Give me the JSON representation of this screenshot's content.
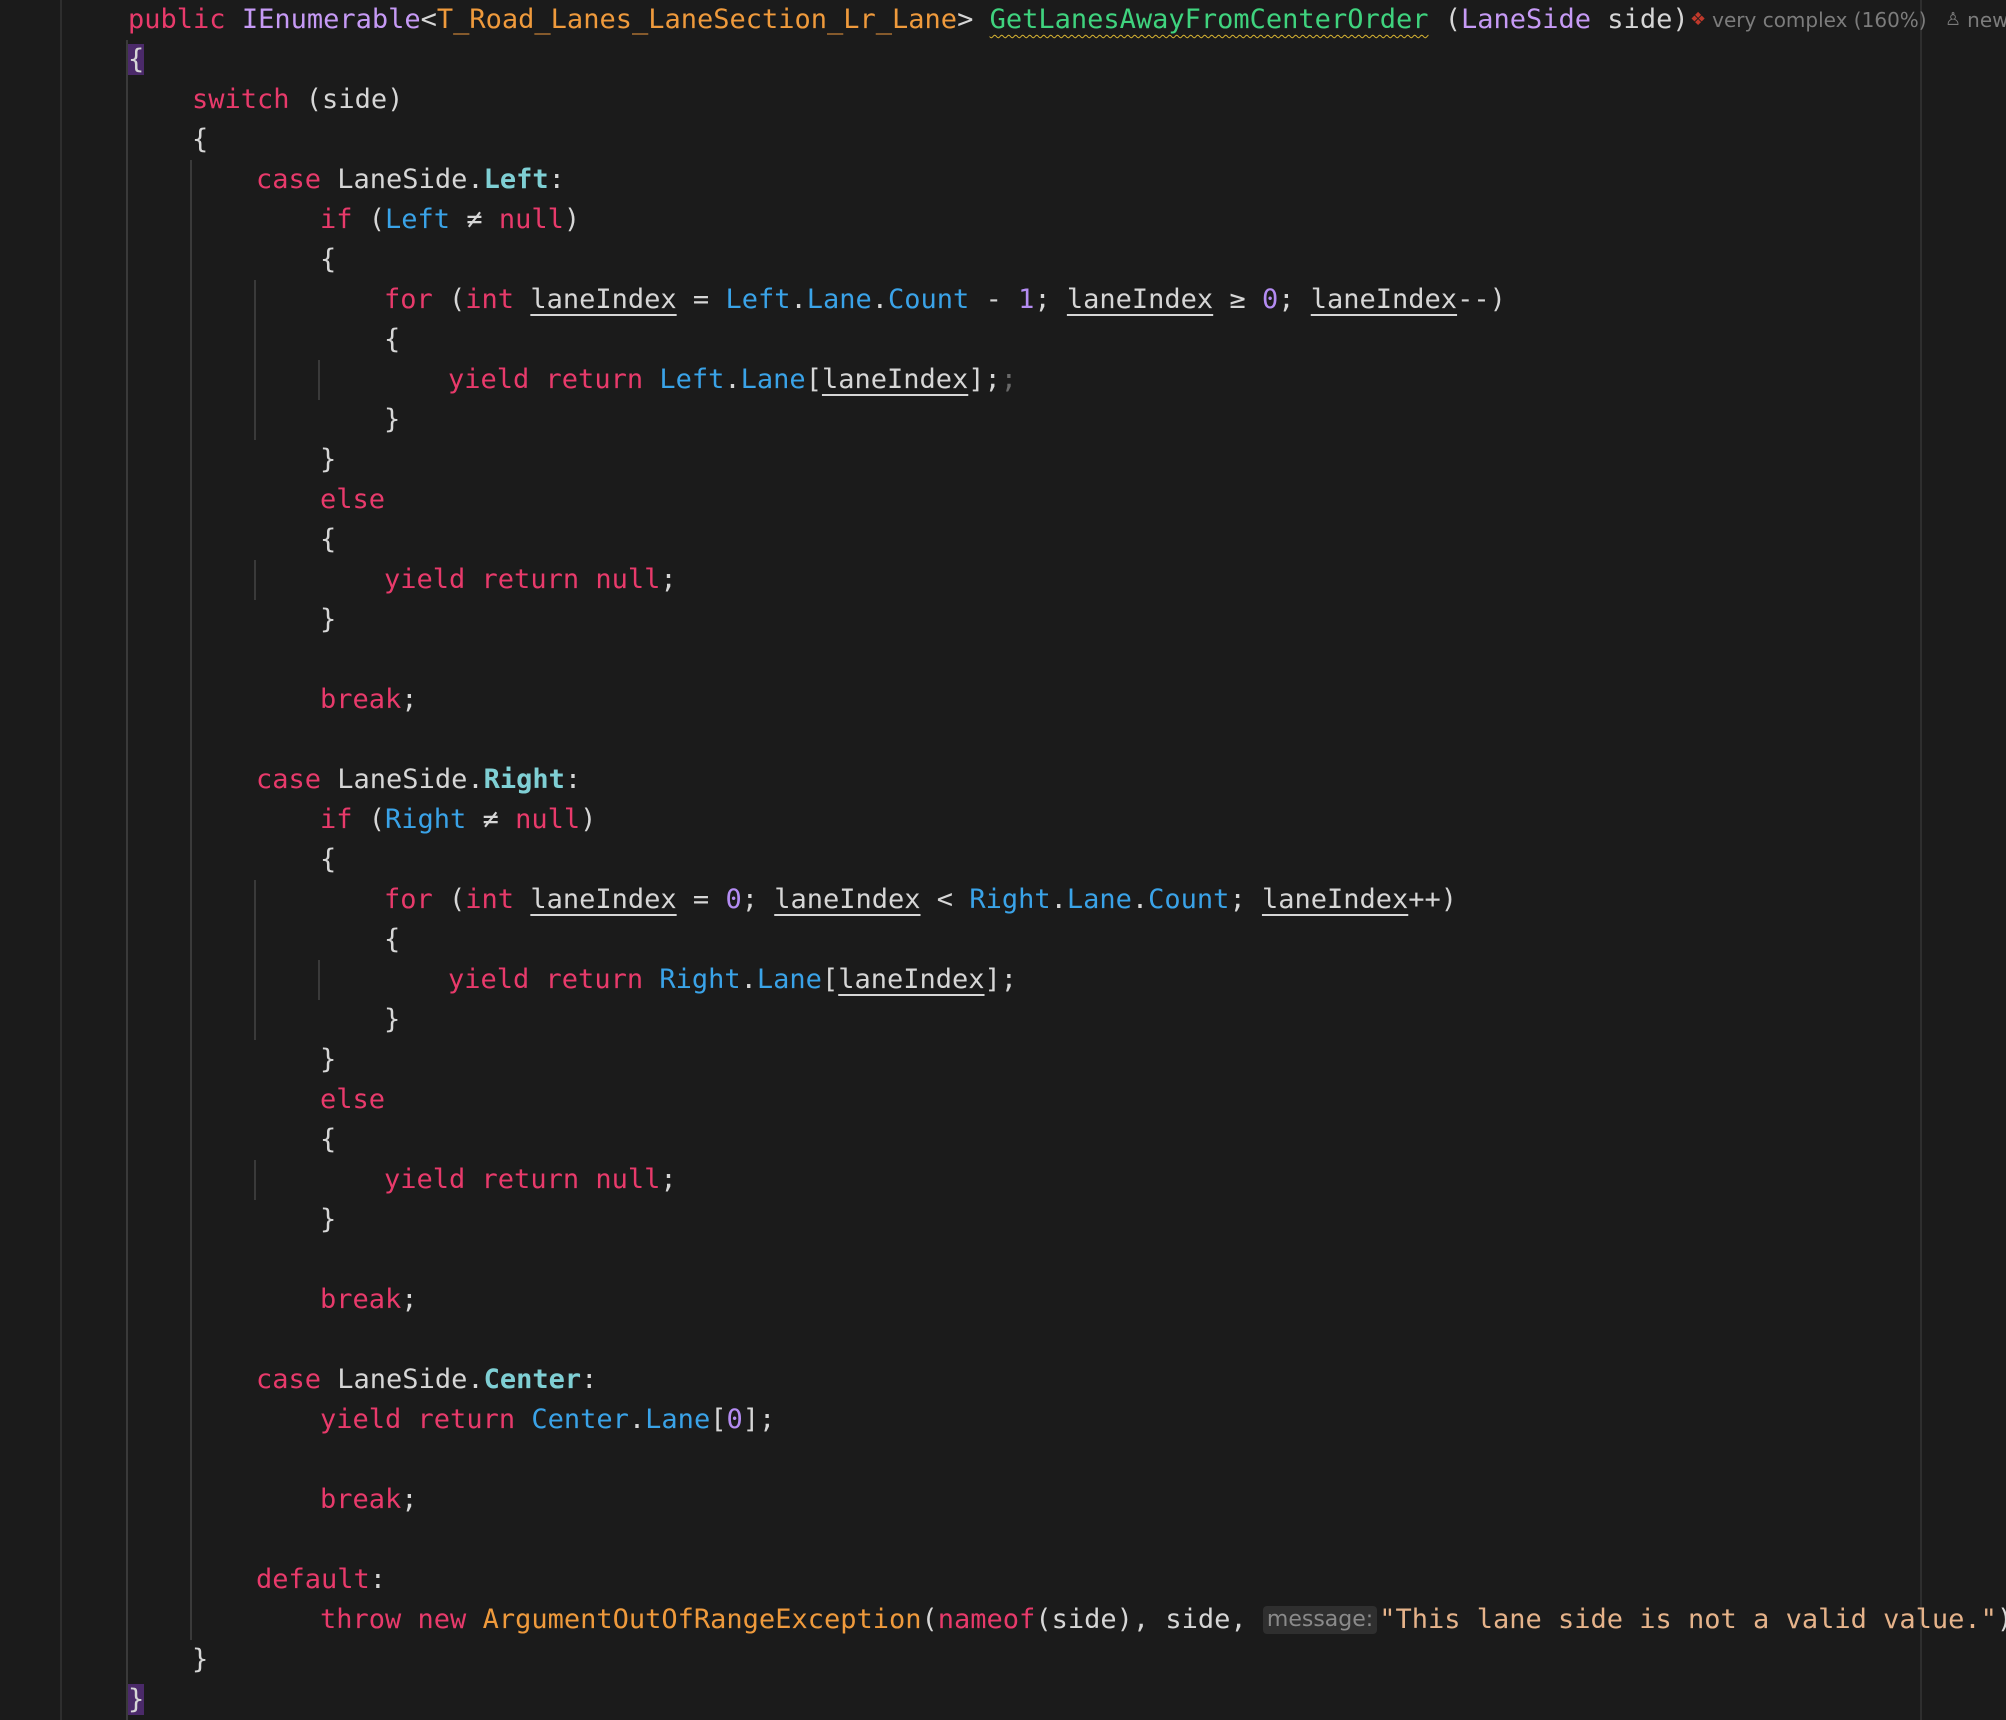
{
  "code_lens": {
    "complexity_icon": "complexity-warning-icon",
    "complexity_label": "very complex (160%)",
    "author_icon": "person-icon",
    "author_label": "new"
  },
  "colors": {
    "background": "#1b1b1b",
    "keyword": "#e83a6b",
    "type": "#c69af5",
    "generic_type": "#ef9a3c",
    "method_name": "#3fd37e",
    "property": "#3aa3e8",
    "enum_member": "#7fcfd4",
    "number": "#b48cf2",
    "string": "#e6b38a",
    "brace_highlight": "#4b2a6a"
  },
  "code_lines": [
    [
      [
        "kw",
        "public"
      ],
      [
        "plain",
        " "
      ],
      [
        "type",
        "IEnumerable"
      ],
      [
        "plain",
        "<"
      ],
      [
        "generic",
        "T_Road_Lanes_LaneSection_Lr_Lane"
      ],
      [
        "plain",
        "> "
      ],
      [
        "method",
        "GetLanesAwayFromCenterOrder"
      ],
      [
        "plain",
        " ("
      ],
      [
        "type",
        "LaneSide"
      ],
      [
        "plain",
        " side)"
      ]
    ],
    [
      [
        "bracehl",
        "{"
      ]
    ],
    [
      [
        "kw",
        "switch"
      ],
      [
        "plain",
        " (side)"
      ]
    ],
    [
      [
        "plain",
        "{"
      ]
    ],
    [
      [
        "kw",
        "case"
      ],
      [
        "plain",
        " LaneSide."
      ],
      [
        "enum",
        "Left"
      ],
      [
        "plain",
        ":"
      ]
    ],
    [
      [
        "kw",
        "if"
      ],
      [
        "plain",
        " ("
      ],
      [
        "prop",
        "Left"
      ],
      [
        "plain",
        " ≠ "
      ],
      [
        "kw",
        "null"
      ],
      [
        "plain",
        ")"
      ]
    ],
    [
      [
        "plain",
        "{"
      ]
    ],
    [
      [
        "kw",
        "for"
      ],
      [
        "plain",
        " ("
      ],
      [
        "kw",
        "int"
      ],
      [
        "plain",
        " "
      ],
      [
        "local",
        "laneIndex"
      ],
      [
        "plain",
        " = "
      ],
      [
        "prop",
        "Left"
      ],
      [
        "plain",
        "."
      ],
      [
        "prop",
        "Lane"
      ],
      [
        "plain",
        "."
      ],
      [
        "prop",
        "Count"
      ],
      [
        "plain",
        " - "
      ],
      [
        "num",
        "1"
      ],
      [
        "plain",
        "; "
      ],
      [
        "local",
        "laneIndex"
      ],
      [
        "plain",
        " ≥ "
      ],
      [
        "num",
        "0"
      ],
      [
        "plain",
        "; "
      ],
      [
        "local",
        "laneIndex"
      ],
      [
        "plain",
        "--)"
      ]
    ],
    [
      [
        "plain",
        "{"
      ]
    ],
    [
      [
        "kw",
        "yield"
      ],
      [
        "plain",
        " "
      ],
      [
        "kw",
        "return"
      ],
      [
        "plain",
        " "
      ],
      [
        "prop",
        "Left"
      ],
      [
        "plain",
        "."
      ],
      [
        "prop",
        "Lane"
      ],
      [
        "plain",
        "["
      ],
      [
        "local",
        "laneIndex"
      ],
      [
        "plain",
        "];"
      ],
      [
        "dim",
        ";"
      ]
    ],
    [
      [
        "plain",
        "}"
      ]
    ],
    [
      [
        "plain",
        "}"
      ]
    ],
    [
      [
        "kw",
        "else"
      ]
    ],
    [
      [
        "plain",
        "{"
      ]
    ],
    [
      [
        "kw",
        "yield"
      ],
      [
        "plain",
        " "
      ],
      [
        "kw",
        "return"
      ],
      [
        "plain",
        " "
      ],
      [
        "kw",
        "null"
      ],
      [
        "plain",
        ";"
      ]
    ],
    [
      [
        "plain",
        "}"
      ]
    ],
    [],
    [
      [
        "kw",
        "break"
      ],
      [
        "plain",
        ";"
      ]
    ],
    [],
    [
      [
        "kw",
        "case"
      ],
      [
        "plain",
        " LaneSide."
      ],
      [
        "enum",
        "Right"
      ],
      [
        "plain",
        ":"
      ]
    ],
    [
      [
        "kw",
        "if"
      ],
      [
        "plain",
        " ("
      ],
      [
        "prop",
        "Right"
      ],
      [
        "plain",
        " ≠ "
      ],
      [
        "kw",
        "null"
      ],
      [
        "plain",
        ")"
      ]
    ],
    [
      [
        "plain",
        "{"
      ]
    ],
    [
      [
        "kw",
        "for"
      ],
      [
        "plain",
        " ("
      ],
      [
        "kw",
        "int"
      ],
      [
        "plain",
        " "
      ],
      [
        "local",
        "laneIndex"
      ],
      [
        "plain",
        " = "
      ],
      [
        "num",
        "0"
      ],
      [
        "plain",
        "; "
      ],
      [
        "local",
        "laneIndex"
      ],
      [
        "plain",
        " < "
      ],
      [
        "prop",
        "Right"
      ],
      [
        "plain",
        "."
      ],
      [
        "prop",
        "Lane"
      ],
      [
        "plain",
        "."
      ],
      [
        "prop",
        "Count"
      ],
      [
        "plain",
        "; "
      ],
      [
        "local",
        "laneIndex"
      ],
      [
        "plain",
        "++)"
      ]
    ],
    [
      [
        "plain",
        "{"
      ]
    ],
    [
      [
        "kw",
        "yield"
      ],
      [
        "plain",
        " "
      ],
      [
        "kw",
        "return"
      ],
      [
        "plain",
        " "
      ],
      [
        "prop",
        "Right"
      ],
      [
        "plain",
        "."
      ],
      [
        "prop",
        "Lane"
      ],
      [
        "plain",
        "["
      ],
      [
        "local",
        "laneIndex"
      ],
      [
        "plain",
        "];"
      ]
    ],
    [
      [
        "plain",
        "}"
      ]
    ],
    [
      [
        "plain",
        "}"
      ]
    ],
    [
      [
        "kw",
        "else"
      ]
    ],
    [
      [
        "plain",
        "{"
      ]
    ],
    [
      [
        "kw",
        "yield"
      ],
      [
        "plain",
        " "
      ],
      [
        "kw",
        "return"
      ],
      [
        "plain",
        " "
      ],
      [
        "kw",
        "null"
      ],
      [
        "plain",
        ";"
      ]
    ],
    [
      [
        "plain",
        "}"
      ]
    ],
    [],
    [
      [
        "kw",
        "break"
      ],
      [
        "plain",
        ";"
      ]
    ],
    [],
    [
      [
        "kw",
        "case"
      ],
      [
        "plain",
        " LaneSide."
      ],
      [
        "enum",
        "Center"
      ],
      [
        "plain",
        ":"
      ]
    ],
    [
      [
        "kw",
        "yield"
      ],
      [
        "plain",
        " "
      ],
      [
        "kw",
        "return"
      ],
      [
        "plain",
        " "
      ],
      [
        "prop",
        "Center"
      ],
      [
        "plain",
        "."
      ],
      [
        "prop",
        "Lane"
      ],
      [
        "plain",
        "["
      ],
      [
        "num",
        "0"
      ],
      [
        "plain",
        "];"
      ]
    ],
    [],
    [
      [
        "kw",
        "break"
      ],
      [
        "plain",
        ";"
      ]
    ],
    [],
    [
      [
        "kw",
        "default"
      ],
      [
        "plain",
        ":"
      ]
    ],
    [
      [
        "kw",
        "throw"
      ],
      [
        "plain",
        " "
      ],
      [
        "kw",
        "new"
      ],
      [
        "plain",
        " "
      ],
      [
        "fn",
        "ArgumentOutOfRangeException"
      ],
      [
        "plain",
        "("
      ],
      [
        "kw",
        "nameof"
      ],
      [
        "plain",
        "(side), side, "
      ],
      [
        "hint",
        "message:"
      ],
      [
        "str",
        "\"This lane side is not a valid value.\""
      ],
      [
        "plain",
        ");"
      ]
    ],
    [
      [
        "plain",
        "}"
      ]
    ],
    [
      [
        "bracehl",
        "}"
      ]
    ]
  ]
}
